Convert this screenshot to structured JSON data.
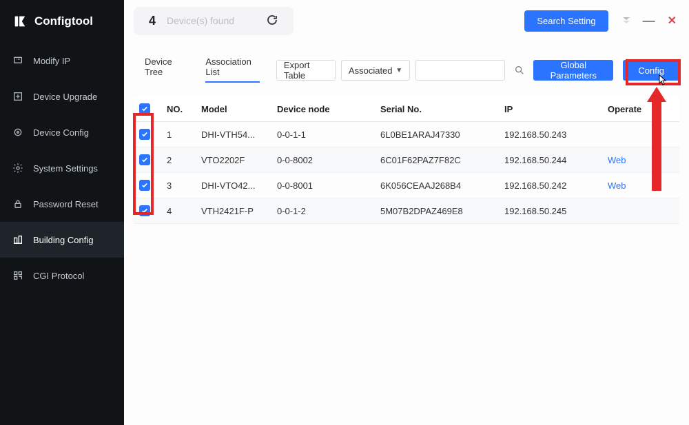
{
  "app": {
    "name": "Configtool"
  },
  "sidebar": {
    "items": [
      {
        "label": "Modify IP"
      },
      {
        "label": "Device Upgrade"
      },
      {
        "label": "Device Config"
      },
      {
        "label": "System Settings"
      },
      {
        "label": "Password Reset"
      },
      {
        "label": "Building Config"
      },
      {
        "label": "CGI Protocol"
      }
    ]
  },
  "topbar": {
    "count": "4",
    "found_text": "Device(s) found",
    "search_setting_label": "Search Setting"
  },
  "toolbar": {
    "tab_device_tree": "Device Tree",
    "tab_association_list": "Association List",
    "export_table_label": "Export Table",
    "dropdown_selected": "Associated",
    "search_placeholder": "",
    "global_params_label": "Global Parameters",
    "config_label": "Config"
  },
  "table": {
    "headers": {
      "no": "NO.",
      "model": "Model",
      "node": "Device node",
      "serial": "Serial No.",
      "ip": "IP",
      "operate": "Operate"
    },
    "rows": [
      {
        "no": "1",
        "model": "DHI-VTH54...",
        "node": "0-0-1-1",
        "serial": "6L0BE1ARAJ47330",
        "ip": "192.168.50.243",
        "operate": ""
      },
      {
        "no": "2",
        "model": "VTO2202F",
        "node": "0-0-8002",
        "serial": "6C01F62PAZ7F82C",
        "ip": "192.168.50.244",
        "operate": "Web"
      },
      {
        "no": "3",
        "model": "DHI-VTO42...",
        "node": "0-0-8001",
        "serial": "6K056CEAAJ268B4",
        "ip": "192.168.50.242",
        "operate": "Web"
      },
      {
        "no": "4",
        "model": "VTH2421F-P",
        "node": "0-0-1-2",
        "serial": "5M07B2DPAZ469E8",
        "ip": "192.168.50.245",
        "operate": ""
      }
    ]
  }
}
